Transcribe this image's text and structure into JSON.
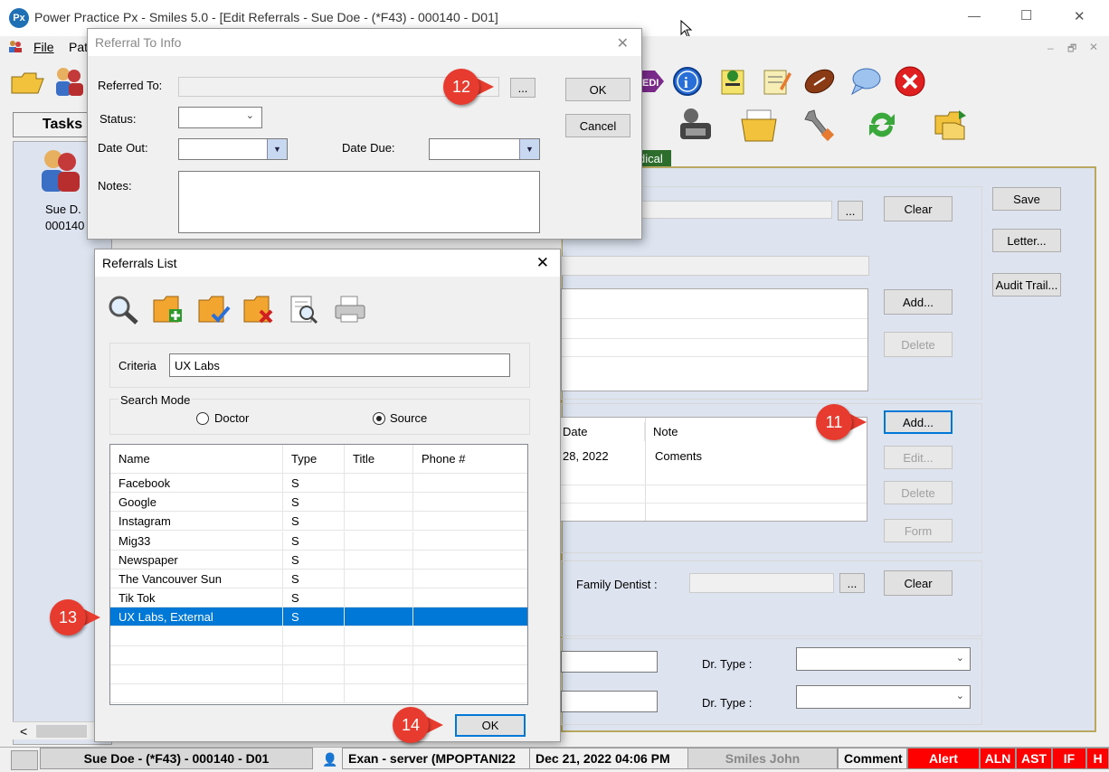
{
  "window": {
    "title": "Power Practice Px - Smiles 5.0 - [Edit Referrals - Sue Doe - (*F43) - 000140 - D01]",
    "app_icon_text": "Px",
    "min": "—",
    "max": "☐",
    "close": "✕"
  },
  "menu": {
    "file": "File",
    "patient_partial": "Pat"
  },
  "mdi": {
    "min": "–",
    "restore": "🗗",
    "close": "✕"
  },
  "left": {
    "tasks": "Tasks",
    "patient_name": "Sue D.",
    "patient_id": "000140",
    "scroll_left": "<"
  },
  "main": {
    "tab_partial": "dical",
    "save": "Save",
    "letter": "Letter...",
    "audit": "Audit Trail...",
    "clear1": "Clear",
    "ellipsis1": "...",
    "add1": "Add...",
    "delete1": "Delete",
    "grid_headers": [
      "Date",
      "Note"
    ],
    "grid_row": {
      "date": "28, 2022",
      "note": "Coments"
    },
    "add2": "Add...",
    "edit2": "Edit...",
    "delete2": "Delete",
    "form2": "Form",
    "family_dentist": "Family Dentist :",
    "ellipsis2": "...",
    "clear2": "Clear",
    "dr_type1": "Dr. Type :",
    "dr_type2": "Dr. Type :"
  },
  "referral_to": {
    "title": "Referral To Info",
    "referred_to": "Referred To:",
    "ellipsis": "...",
    "ok": "OK",
    "cancel": "Cancel",
    "status": "Status:",
    "date_out": "Date Out:",
    "date_due": "Date Due:",
    "notes": "Notes:"
  },
  "referrals_list": {
    "title": "Referrals List",
    "criteria_label": "Criteria",
    "criteria_value": "UX Labs",
    "search_mode": "Search Mode",
    "mode_doctor": "Doctor",
    "mode_source": "Source",
    "selected_mode": "Source",
    "columns": [
      "Name",
      "Type",
      "Title",
      "Phone #"
    ],
    "rows": [
      {
        "name": "Facebook",
        "type": "S",
        "title": "",
        "phone": ""
      },
      {
        "name": "Google",
        "type": "S",
        "title": "",
        "phone": ""
      },
      {
        "name": "Instagram",
        "type": "S",
        "title": "",
        "phone": ""
      },
      {
        "name": "Mig33",
        "type": "S",
        "title": "",
        "phone": ""
      },
      {
        "name": "Newspaper",
        "type": "S",
        "title": "",
        "phone": ""
      },
      {
        "name": "The Vancouver Sun",
        "type": "S",
        "title": "",
        "phone": ""
      },
      {
        "name": "Tik Tok",
        "type": "S",
        "title": "",
        "phone": ""
      },
      {
        "name": "UX Labs, External",
        "type": "S",
        "title": "",
        "phone": ""
      }
    ],
    "selected_row": "UX Labs, External",
    "ok": "OK"
  },
  "badges": {
    "b11": "11",
    "b12": "12",
    "b13": "13",
    "b14": "14"
  },
  "status_bar": {
    "patient": "Sue Doe - (*F43) - 000140 - D01",
    "exam": "Exan - server (MPOPTANI22",
    "datetime": "Dec 21, 2022 04:06 PM",
    "user": "Smiles John",
    "comment": "Comment",
    "alert": "Alert",
    "aln": "ALN",
    "ast": "AST",
    "if": "IF",
    "h": "H"
  },
  "colors": {
    "selection": "#0078d7",
    "badge": "#e63b2e",
    "alert": "#ff0000",
    "main_bg": "#dde4f0"
  }
}
